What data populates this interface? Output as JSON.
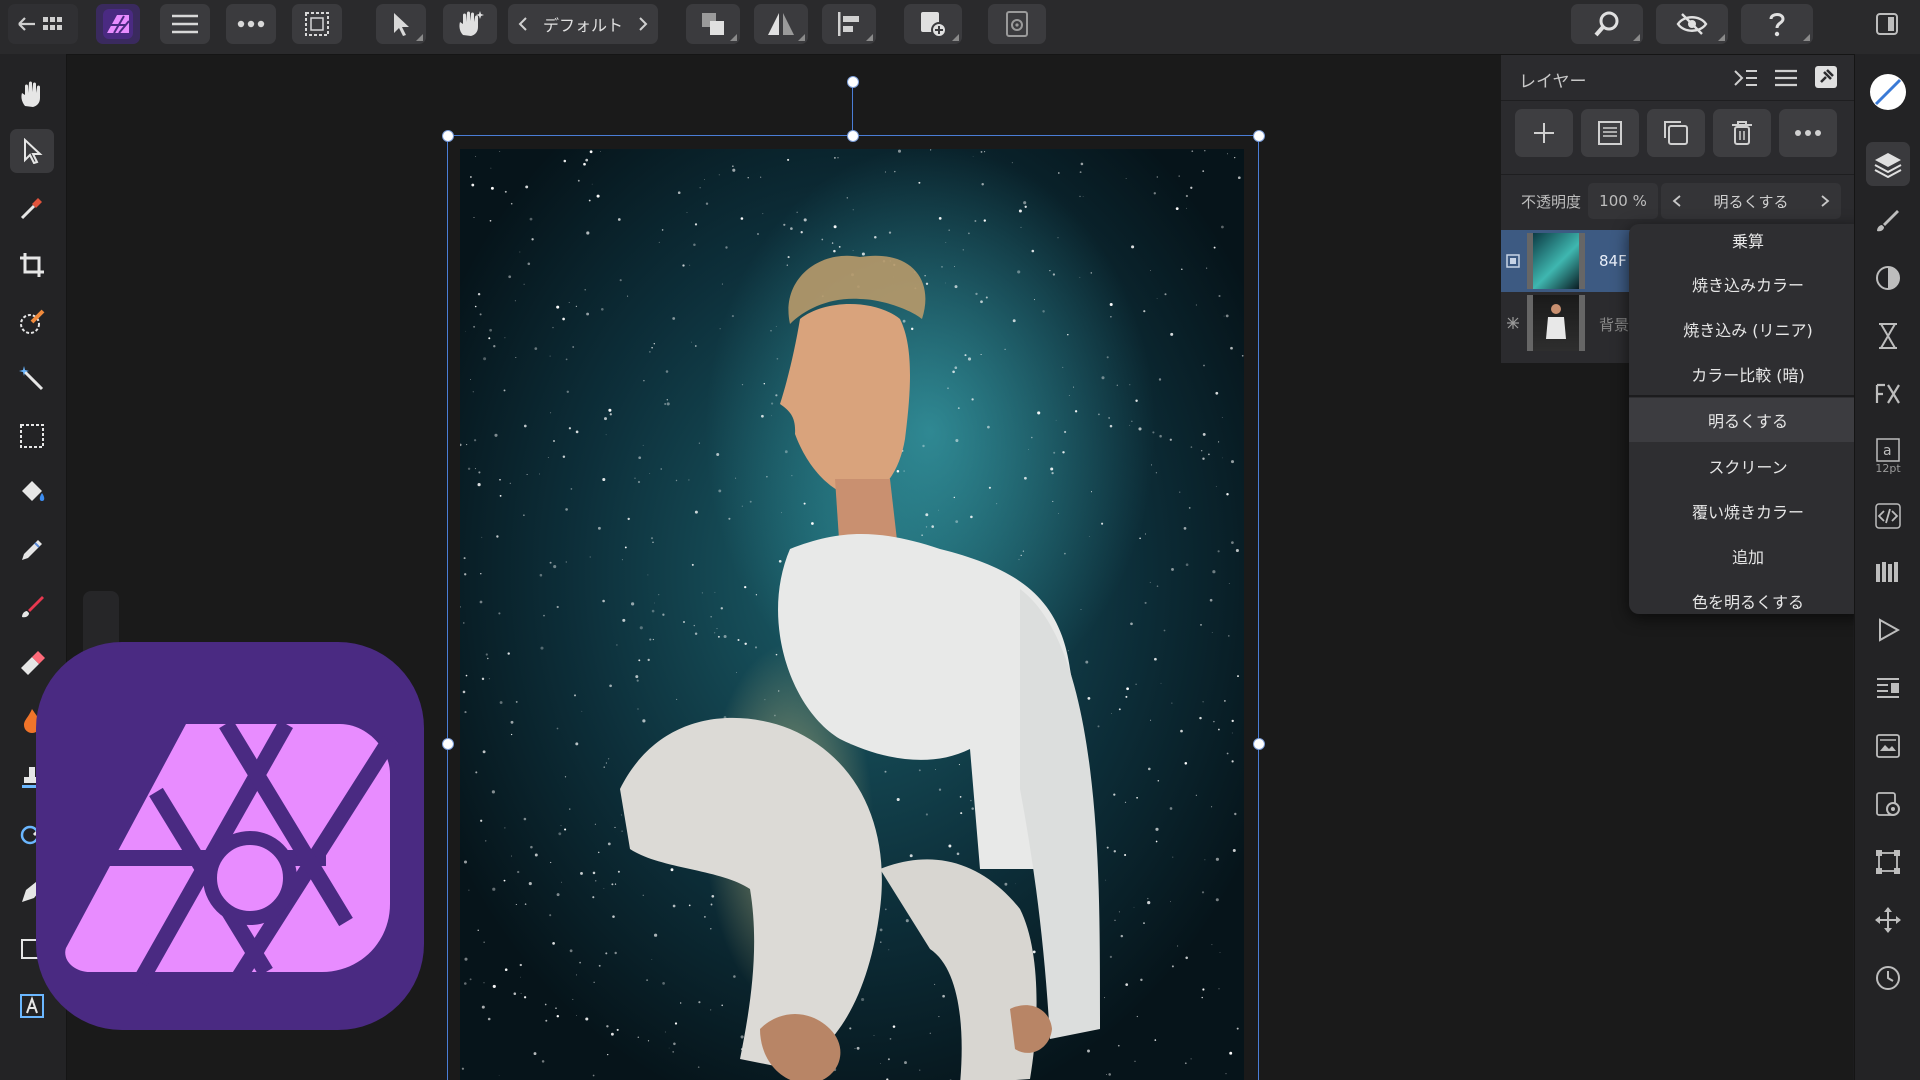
{
  "toolbar": {
    "persona_label": "デフォルト",
    "accent_color": "#9b4dff"
  },
  "layers_panel": {
    "title": "レイヤー",
    "opacity_label": "不透明度",
    "opacity_value": "100 %",
    "blend_mode": "明るくする",
    "layers": [
      {
        "name": "84F",
        "type": "pixel"
      },
      {
        "name": "背景",
        "type": "background"
      }
    ]
  },
  "blend_menu": {
    "items": [
      "乗算",
      "焼き込みカラー",
      "焼き込み (リニア)",
      "カラー比較 (暗)",
      "明るくする",
      "スクリーン",
      "覆い焼きカラー",
      "追加",
      "色を明るくする"
    ],
    "selected": "明るくする"
  },
  "right_strip": {
    "text_style_size": "12pt"
  },
  "logo": {
    "fill_color": "#e88cff",
    "frame_color": "#4a2a82"
  }
}
